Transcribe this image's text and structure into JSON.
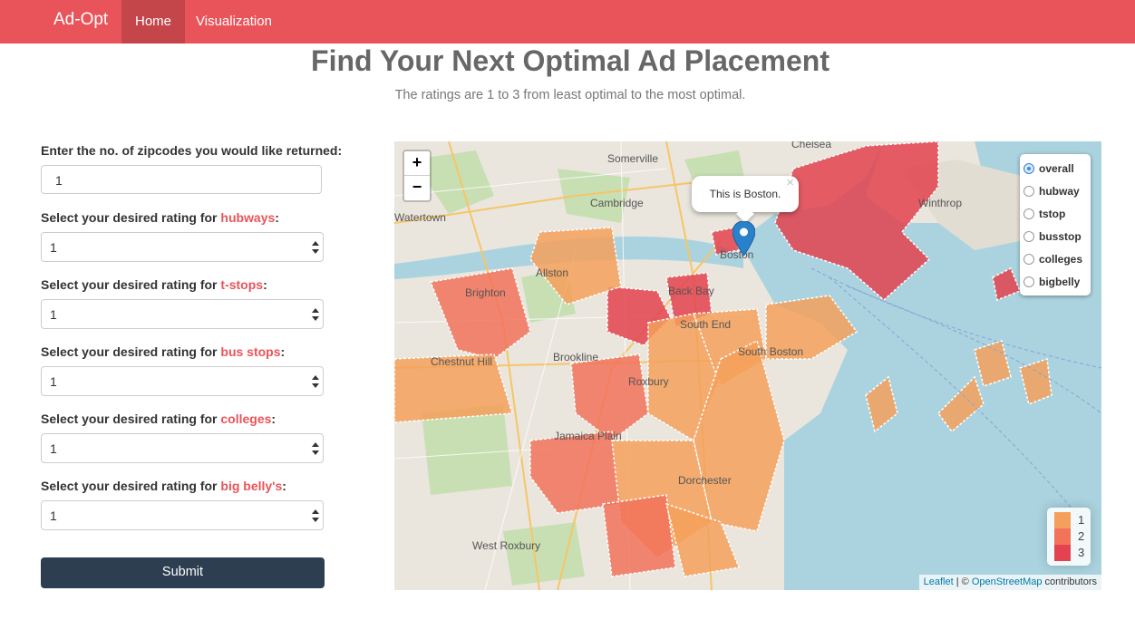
{
  "navbar": {
    "brand": "Ad-Opt",
    "items": [
      "Home",
      "Visualization"
    ],
    "active": "Home",
    "color": "#e9545a"
  },
  "page": {
    "title": "Find Your Next Optimal Ad Placement",
    "subtitle": "The ratings are 1 to 3 from least optimal to the most optimal."
  },
  "form": {
    "zipcodes": {
      "label": "Enter the no. of zipcodes you would like returned:",
      "value": "1"
    },
    "fields": [
      {
        "prefix": "Select your desired rating for ",
        "keyword": "hubways",
        "suffix": ":",
        "value": "1"
      },
      {
        "prefix": "Select your desired rating for ",
        "keyword": "t-stops",
        "suffix": ":",
        "value": "1"
      },
      {
        "prefix": "Select your desired rating for ",
        "keyword": "bus stops",
        "suffix": ":",
        "value": "1"
      },
      {
        "prefix": "Select your desired rating for ",
        "keyword": "colleges",
        "suffix": ":",
        "value": "1"
      },
      {
        "prefix": "Select your desired rating for ",
        "keyword": "big belly's",
        "suffix": ":",
        "value": "1"
      }
    ],
    "submit_label": "Submit"
  },
  "map": {
    "zoom_in": "+",
    "zoom_out": "−",
    "popup_text": "This is Boston.",
    "popup_close": "×",
    "layers": [
      {
        "label": "overall",
        "selected": true
      },
      {
        "label": "hubway",
        "selected": false
      },
      {
        "label": "tstop",
        "selected": false
      },
      {
        "label": "busstop",
        "selected": false
      },
      {
        "label": "colleges",
        "selected": false
      },
      {
        "label": "bigbelly",
        "selected": false
      }
    ],
    "legend": [
      {
        "label": "1",
        "color": "#f4a05c"
      },
      {
        "label": "2",
        "color": "#f2725a"
      },
      {
        "label": "3",
        "color": "#e3424f"
      }
    ],
    "place_labels": [
      "Somerville",
      "Chelsea",
      "Cambridge",
      "Watertown",
      "Winthrop",
      "Brighton",
      "Allston",
      "Back Bay",
      "Boston",
      "South End",
      "South Boston",
      "Brookline",
      "Chestnut Hill",
      "Roxbury",
      "Jamaica Plain",
      "Dorchester",
      "West Roxbury"
    ],
    "attribution": {
      "leaflet": "Leaflet",
      "sep": " | © ",
      "osm": "OpenStreetMap",
      "rest": " contributors"
    }
  }
}
